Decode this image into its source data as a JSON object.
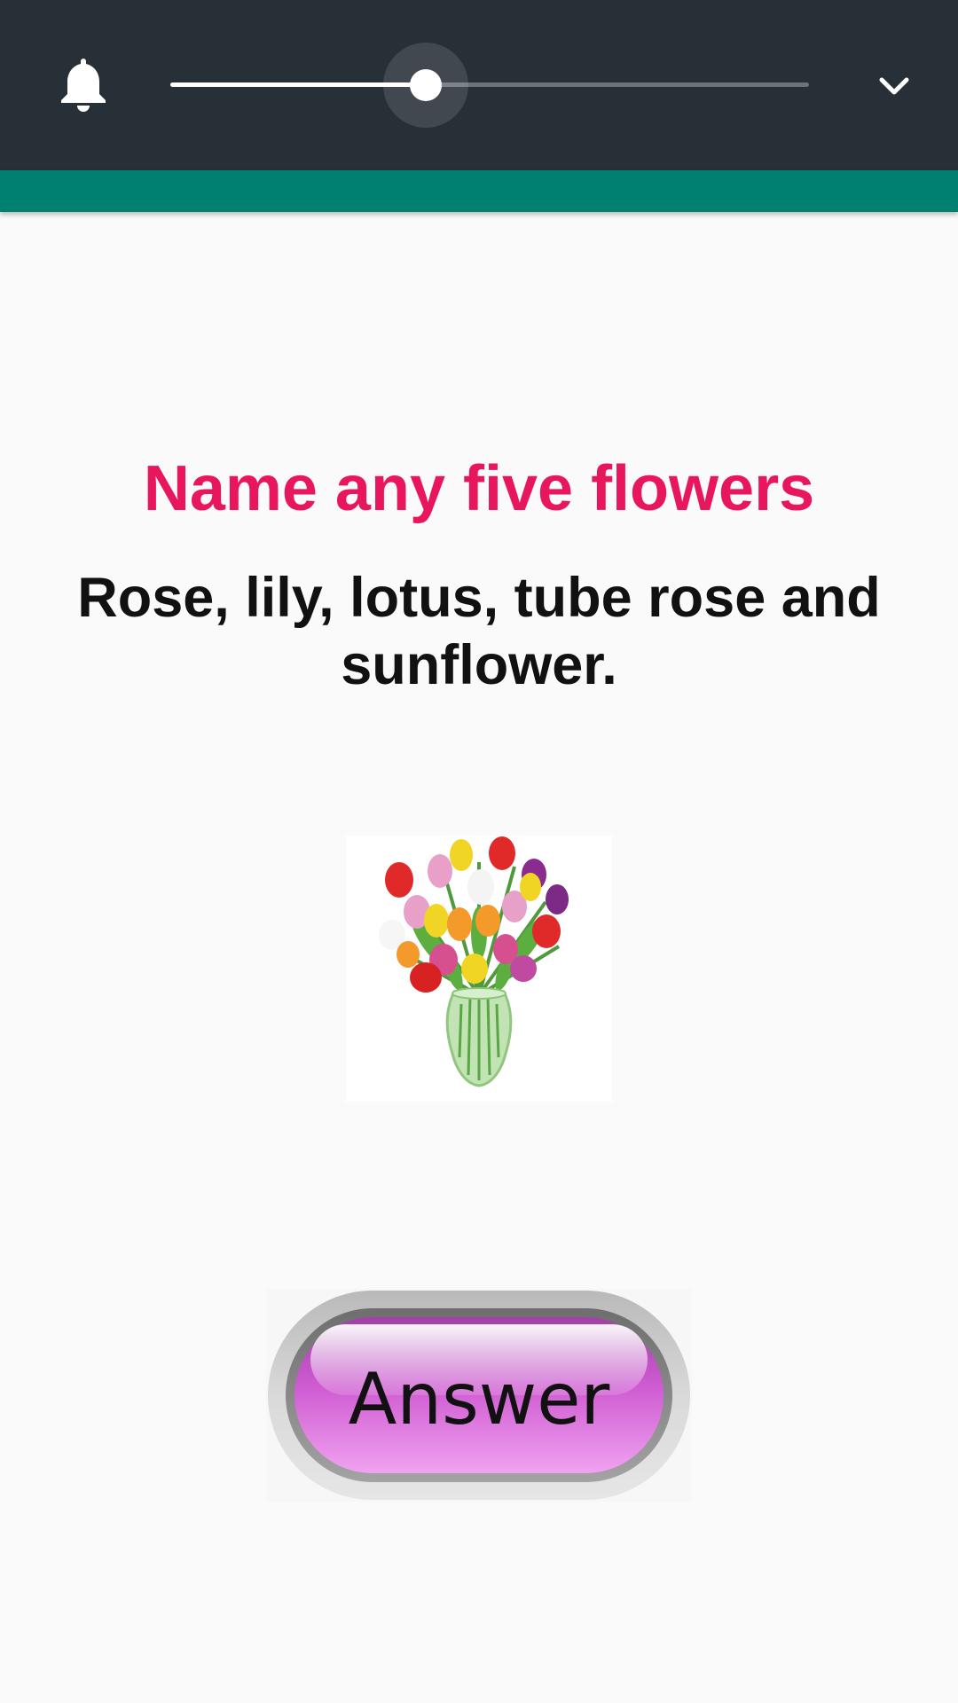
{
  "volume_panel": {
    "bell_icon": "bell-icon",
    "volume_level": 0.4,
    "expand_icon": "chevron-down-icon"
  },
  "content": {
    "question": "Name any five flowers",
    "answer": "Rose, lily, lotus, tube rose and sunflower.",
    "image_icon": "flower-vase-icon"
  },
  "answer_button": {
    "label": "Answer"
  },
  "colors": {
    "panel_bg": "#272f37",
    "app_bar": "#00806e",
    "question": "#e8175d",
    "button_fill": "#d65fd6"
  }
}
